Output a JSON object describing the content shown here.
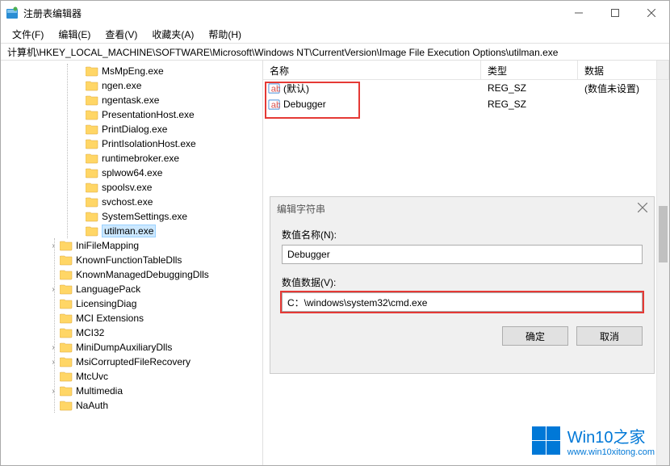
{
  "window": {
    "title": "注册表编辑器"
  },
  "menu": {
    "file": "文件(F)",
    "edit": "编辑(E)",
    "view": "查看(V)",
    "favorites": "收藏夹(A)",
    "help": "帮助(H)"
  },
  "path": "计算机\\HKEY_LOCAL_MACHINE\\SOFTWARE\\Microsoft\\Windows NT\\CurrentVersion\\Image File Execution Options\\utilman.exe",
  "tree_items_l3": [
    "MsMpEng.exe",
    "ngen.exe",
    "ngentask.exe",
    "PresentationHost.exe",
    "PrintDialog.exe",
    "PrintIsolationHost.exe",
    "runtimebroker.exe",
    "splwow64.exe",
    "spoolsv.exe",
    "svchost.exe",
    "SystemSettings.exe",
    "utilman.exe"
  ],
  "tree_items_l2": [
    "IniFileMapping",
    "KnownFunctionTableDlls",
    "KnownManagedDebuggingDlls",
    "LanguagePack",
    "LicensingDiag",
    "MCI Extensions",
    "MCI32",
    "MiniDumpAuxiliaryDlls",
    "MsiCorruptedFileRecovery",
    "MtcUvc",
    "Multimedia",
    "NaAuth"
  ],
  "tree_selected": "utilman.exe",
  "values_header": {
    "name": "名称",
    "type": "类型",
    "data": "数据"
  },
  "values": [
    {
      "name": "(默认)",
      "type": "REG_SZ",
      "data": "(数值未设置)"
    },
    {
      "name": "Debugger",
      "type": "REG_SZ",
      "data": ""
    }
  ],
  "dialog": {
    "title": "编辑字符串",
    "name_label": "数值名称(N):",
    "name_value": "Debugger",
    "data_label": "数值数据(V):",
    "data_value": "C：\\windows\\system32\\cmd.exe",
    "ok": "确定",
    "cancel": "取消"
  },
  "watermark": {
    "big": "Win10之家",
    "small": "www.win10xitong.com"
  }
}
